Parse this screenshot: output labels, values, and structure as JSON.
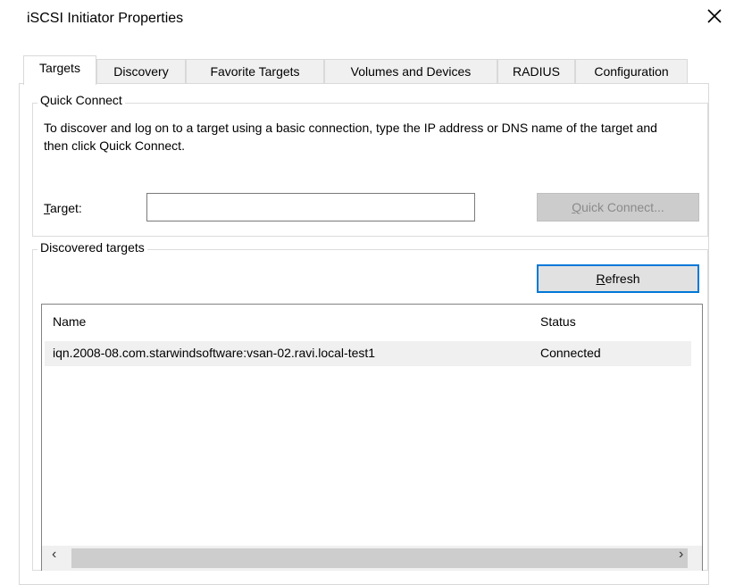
{
  "window": {
    "title": "iSCSI Initiator Properties"
  },
  "tabs": [
    {
      "label": "Targets",
      "active": true
    },
    {
      "label": "Discovery"
    },
    {
      "label": "Favorite Targets"
    },
    {
      "label": "Volumes and Devices"
    },
    {
      "label": "RADIUS"
    },
    {
      "label": "Configuration"
    }
  ],
  "quick_connect": {
    "group_label": "Quick Connect",
    "description": "To discover and log on to a target using a basic connection, type the IP address or DNS name of the target and then click Quick Connect.",
    "target_label": "Target:",
    "target_value": "",
    "button_label": "Quick Connect..."
  },
  "discovered_targets": {
    "group_label": "Discovered targets",
    "refresh_label": "Refresh",
    "columns": [
      "Name",
      "Status"
    ],
    "rows": [
      {
        "name": "iqn.2008-08.com.starwindsoftware:vsan-02.ravi.local-test1",
        "status": "Connected"
      }
    ]
  },
  "icons": {
    "close": "close-icon",
    "scroll_left": "chevron-left-icon",
    "scroll_right": "chevron-right-icon"
  }
}
